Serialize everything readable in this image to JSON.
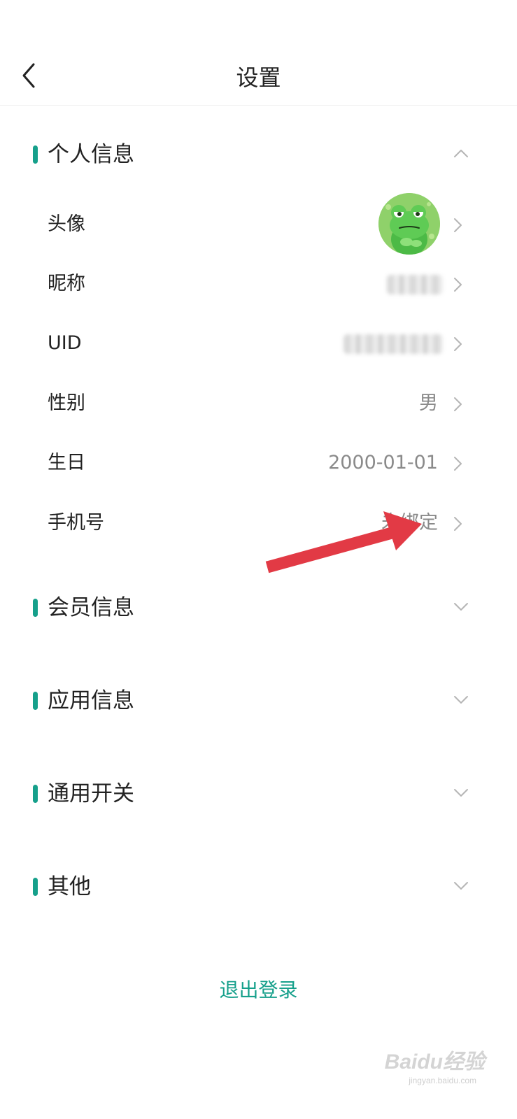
{
  "header": {
    "title": "设置"
  },
  "sections": {
    "personal": {
      "title": "个人信息",
      "expanded": true
    },
    "member": {
      "title": "会员信息",
      "expanded": false
    },
    "app": {
      "title": "应用信息",
      "expanded": false
    },
    "general": {
      "title": "通用开关",
      "expanded": false
    },
    "other": {
      "title": "其他",
      "expanded": false
    }
  },
  "rows": {
    "avatar": {
      "label": "头像"
    },
    "nickname": {
      "label": "昵称",
      "value_blurred": true
    },
    "uid": {
      "label": "UID",
      "value_blurred": true
    },
    "gender": {
      "label": "性别",
      "value": "男"
    },
    "birthday": {
      "label": "生日",
      "value": "2000-01-01"
    },
    "phone": {
      "label": "手机号",
      "value": "未绑定"
    }
  },
  "logout": {
    "label": "退出登录"
  },
  "watermark": {
    "brand": "Baidu经验",
    "url": "jingyan.baidu.com"
  },
  "colors": {
    "accent": "#16a08b",
    "annotation_arrow": "#e23a45",
    "avatar_bg": "#8fd16a"
  },
  "icons": {
    "back": "back-chevron-icon",
    "row_chevron": "chevron-right-icon",
    "expand": "chevron-down-icon",
    "collapse": "chevron-up-icon"
  }
}
